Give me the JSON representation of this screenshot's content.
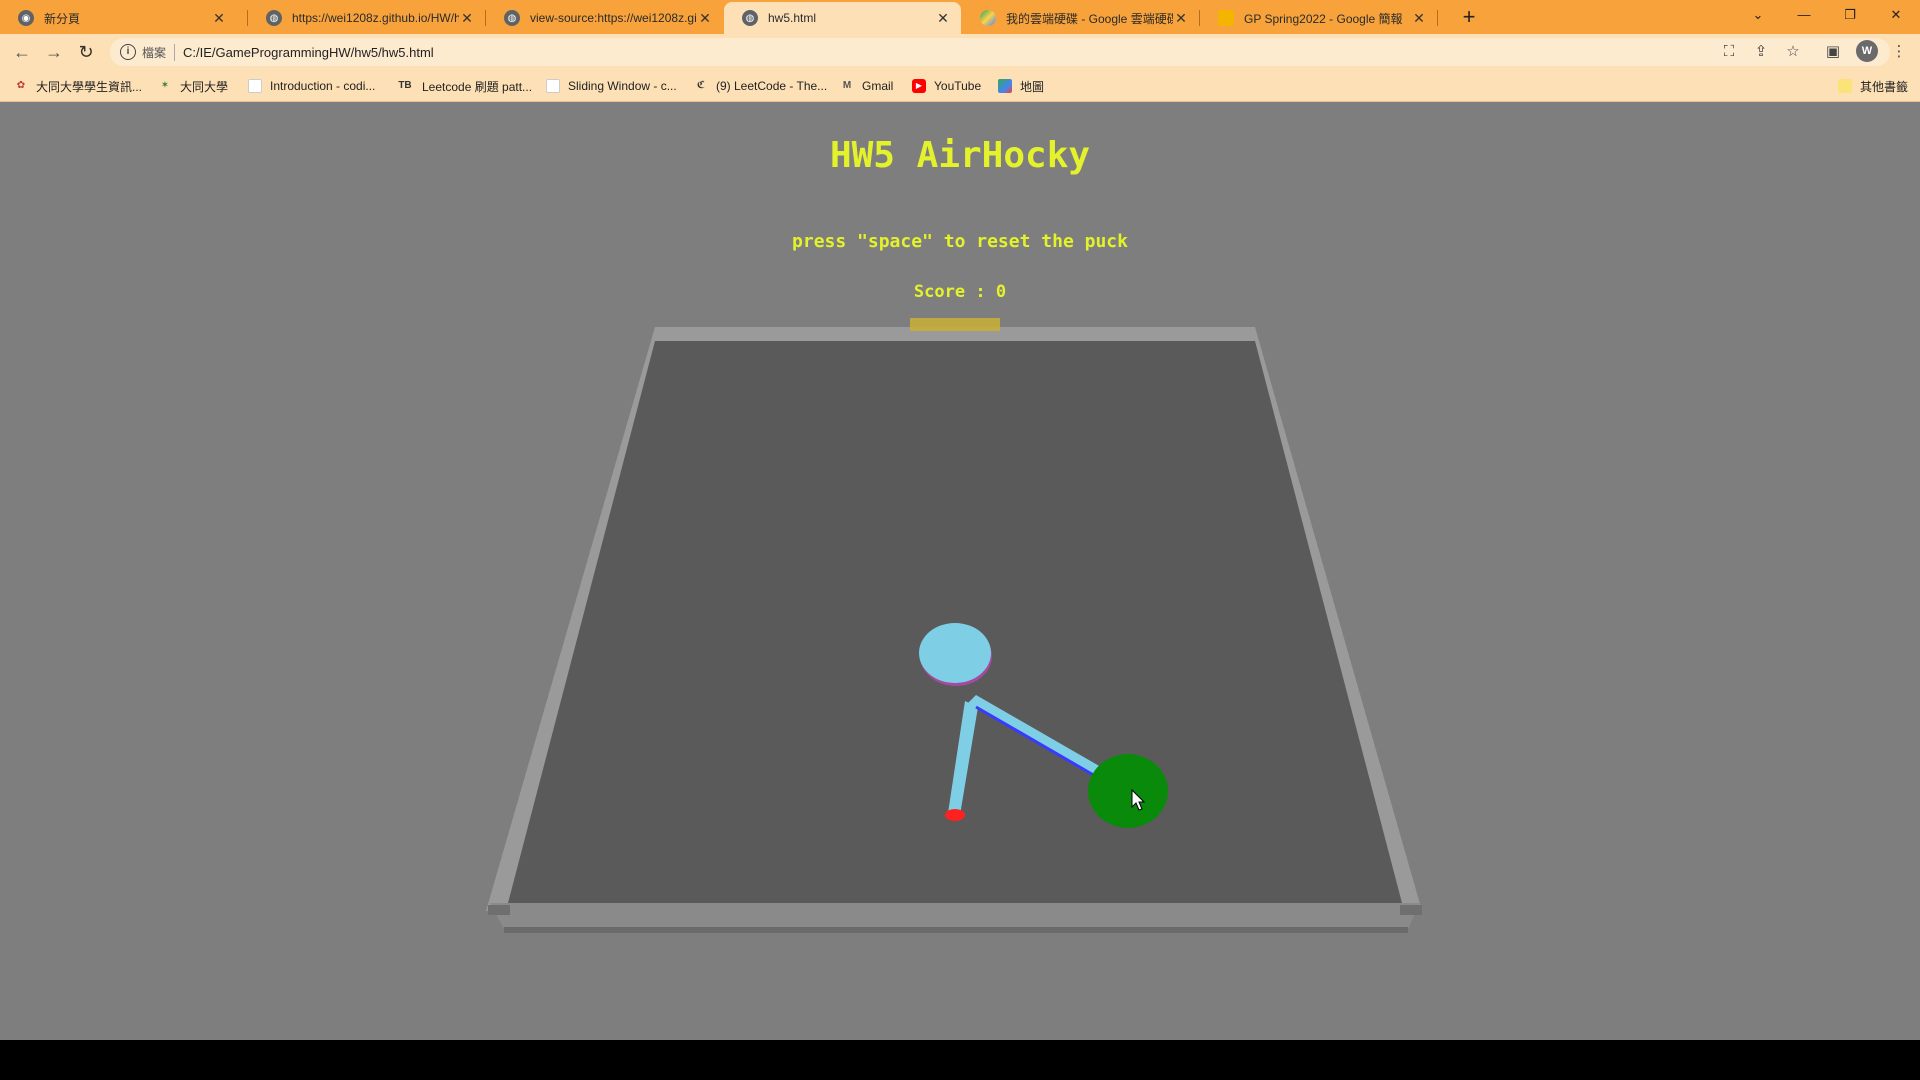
{
  "tabs": [
    {
      "label": "新分頁",
      "active": false,
      "icon": "chrome-icon"
    },
    {
      "label": "https://wei1208z.github.io/HW/h",
      "active": false,
      "icon": "globe-icon"
    },
    {
      "label": "view-source:https://wei1208z.gi",
      "active": false,
      "icon": "globe-icon"
    },
    {
      "label": "hw5.html",
      "active": true,
      "icon": "globe-icon"
    },
    {
      "label": "我的雲端硬碟 - Google 雲端硬碟",
      "active": false,
      "icon": "drive-icon"
    },
    {
      "label": "GP Spring2022 - Google 簡報",
      "active": false,
      "icon": "slides-icon"
    }
  ],
  "toolbar": {
    "scheme_label": "檔案",
    "url": "C:/IE/GameProgrammingHW/hw5/hw5.html",
    "avatar_letter": "W"
  },
  "bookmarks": [
    {
      "label": "大同大學學生資訊...",
      "icon": "tatung-icon"
    },
    {
      "label": "大同大學",
      "icon": "tatung-logo-icon"
    },
    {
      "label": "Introduction - codi...",
      "icon": "page-icon"
    },
    {
      "label": "Leetcode 刷題 patt...",
      "icon": "tb-icon"
    },
    {
      "label": "Sliding Window - c...",
      "icon": "page-icon"
    },
    {
      "label": "(9) LeetCode - The...",
      "icon": "leetcode-icon"
    },
    {
      "label": "Gmail",
      "icon": "gmail-icon"
    },
    {
      "label": "YouTube",
      "icon": "youtube-icon"
    },
    {
      "label": "地圖",
      "icon": "maps-icon"
    }
  ],
  "other_bookmarks": "其他書籤",
  "page": {
    "title": "HW5 AirHocky",
    "hint": "press \"space\" to reset the puck",
    "score_label": "Score : ",
    "score": "0",
    "text_color": "#e4f22c",
    "table_color": "#5a5a5a",
    "rail_color": "#9a9a9a",
    "goal_color": "#c8ad3a",
    "puck_color": "#7ecfe6",
    "arm_color": "#7ecfe6",
    "arm_end_color": "#ff2020",
    "mallet_color": "#0a8a0a"
  }
}
